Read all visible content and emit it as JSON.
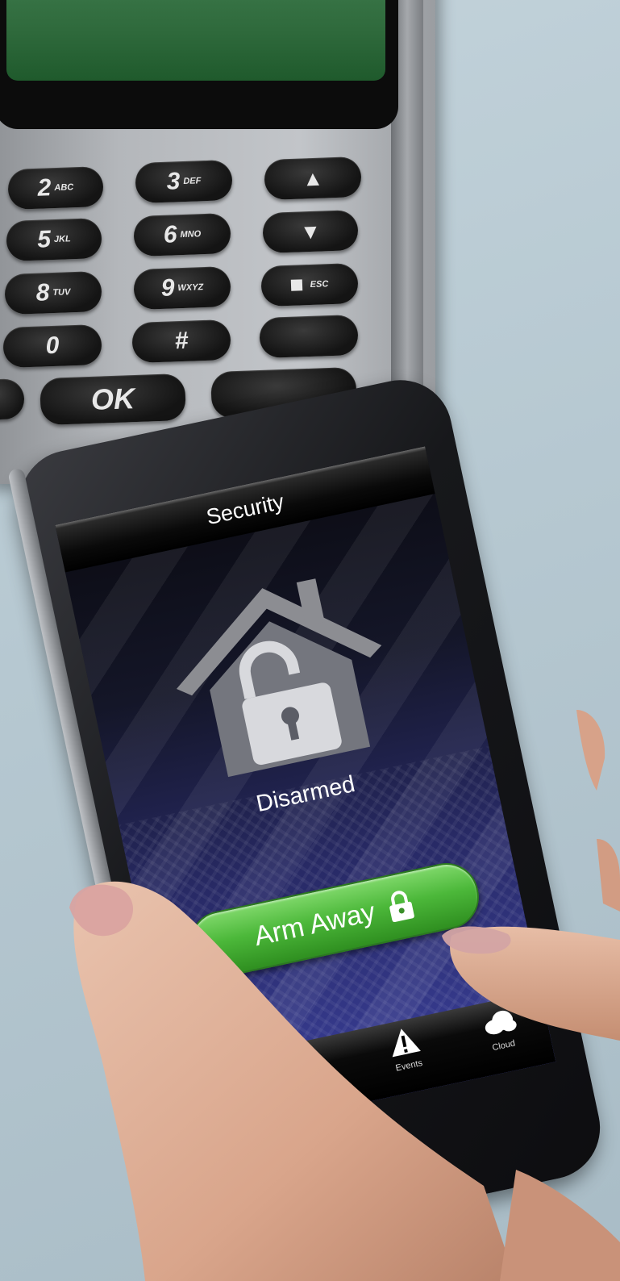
{
  "keypad": {
    "keys": [
      {
        "digit": "2",
        "letters": "ABC"
      },
      {
        "digit": "3",
        "letters": "DEF"
      },
      {
        "digit": "5",
        "letters": "JKL"
      },
      {
        "digit": "6",
        "letters": "MNO"
      },
      {
        "digit": "8",
        "letters": "TUV"
      },
      {
        "digit": "9",
        "letters": "WXYZ"
      },
      {
        "digit": "0",
        "letters": ""
      },
      {
        "digit": "#",
        "letters": ""
      }
    ],
    "up_icon": "up-arrow-icon",
    "down_icon": "down-arrow-icon",
    "esc_label": "ESC",
    "ok_label": "OK"
  },
  "app": {
    "title": "Security",
    "status": "Disarmed",
    "status_icon": "house-unlocked-icon",
    "arm_button_label": "Arm Away",
    "arm_button_icon": "padlock-icon",
    "tabs": [
      {
        "label": "Events",
        "icon": "warning-icon"
      },
      {
        "label": "Cloud",
        "icon": "cloud-icon"
      }
    ]
  },
  "colors": {
    "arm_button_green": "#4cb83a",
    "screen_blue": "#3a3f9a",
    "lcd_green": "#2f6a3c",
    "wall": "#b6c8d1"
  }
}
